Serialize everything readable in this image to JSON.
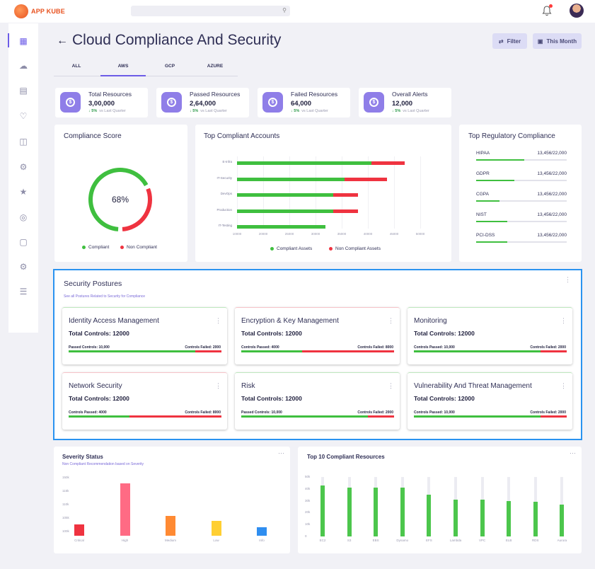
{
  "app": {
    "name": "APP KUBE"
  },
  "header": {
    "title": "Cloud Compliance And Security",
    "filter_label": "Filter",
    "period_label": "This Month"
  },
  "tabs": [
    {
      "label": "ALL"
    },
    {
      "label": "AWS"
    },
    {
      "label": "GCP"
    },
    {
      "label": "AZURE"
    }
  ],
  "active_tab": "AWS",
  "stats": [
    {
      "label": "Total Resources",
      "value": "3,00,000",
      "delta": "5%",
      "vs": "vs Last Quarter"
    },
    {
      "label": "Passed Resources",
      "value": "2,64,000",
      "delta": "5%",
      "vs": "vs Last Quarter"
    },
    {
      "label": "Failed Resources",
      "value": "64,000",
      "delta": "5%",
      "vs": "vs Last Quarter"
    },
    {
      "label": "Overall Alerts",
      "value": "12,000",
      "delta": "5%",
      "vs": "vs Last Quarter"
    }
  ],
  "compliance_score": {
    "title": "Compliance Score",
    "value": "68%",
    "percent": 68,
    "legend": [
      {
        "label": "Compliant",
        "color": "#3fbf3f"
      },
      {
        "label": "Non Compliant",
        "color": "#ef3340"
      }
    ]
  },
  "top_accounts": {
    "title": "Top Compliant Accounts",
    "legend": [
      {
        "label": "Compliant Assets",
        "color": "#3fbf3f"
      },
      {
        "label": "Non Compliant Assets",
        "color": "#ef3340"
      }
    ]
  },
  "regulatory": {
    "title": "Top Regulatory Compliance",
    "items": [
      {
        "name": "HIPAA",
        "value": "13,456/22,000",
        "fraction": 0.53
      },
      {
        "name": "GDPR",
        "value": "13,456/22,000",
        "fraction": 0.42
      },
      {
        "name": "CGPA",
        "value": "13,456/22,000",
        "fraction": 0.26
      },
      {
        "name": "NIST",
        "value": "13,456/22,000",
        "fraction": 0.34
      },
      {
        "name": "PCI-DSS",
        "value": "13,456/22,000",
        "fraction": 0.34
      }
    ]
  },
  "security": {
    "title": "Security Postures",
    "subtitle": "See all Postures Related to Security for Compliance",
    "more": "⋮",
    "cards": [
      {
        "title": "Identity Access Management",
        "total": "Total Controls:  12000",
        "passed": "Passed Controls: 10,000",
        "failed": "Controls Failed: 2000",
        "pass_fraction": 0.83,
        "top": "green"
      },
      {
        "title": "Encryption & Key Management",
        "total": "Total Controls:  12000",
        "passed": "Controls Passed: 4000",
        "failed": "Controls Failed: 8000",
        "pass_fraction": 0.4,
        "top": "red"
      },
      {
        "title": "Monitoring",
        "total": "Total Controls:  12000",
        "passed": "Controls Passed: 10,000",
        "failed": "Controls Failed: 2000",
        "pass_fraction": 0.83,
        "top": "green"
      },
      {
        "title": "Network Security",
        "total": "Total Controls:  12000",
        "passed": "Controls Passed: 4000",
        "failed": "Controls Failed: 8000",
        "pass_fraction": 0.4,
        "top": "red"
      },
      {
        "title": "Risk",
        "total": "Total Controls:  12000",
        "passed": "Passed Controls: 10,000",
        "failed": "Controls Failed: 2000",
        "pass_fraction": 0.83,
        "top": "green"
      },
      {
        "title": "Vulnerability And Threat Management",
        "total": "Total Controls:  12000",
        "passed": "Controls Passed: 10,000",
        "failed": "Controls Failed: 2000",
        "pass_fraction": 0.83,
        "top": "green"
      }
    ]
  },
  "severity": {
    "title": "Severity Status",
    "subtitle": "Non Compliant  Recommendation based on Severity",
    "more": "···"
  },
  "top_resources": {
    "title": "Top 10 Compliant Resources",
    "more": "···"
  },
  "chart_data": [
    {
      "type": "bar",
      "orientation": "horizontal",
      "stacked": true,
      "categories": [
        "E-Infra",
        "IT-Security",
        "DevOps",
        "Production",
        "IT-Testing"
      ],
      "series": [
        {
          "name": "Compliant Assets",
          "color": "#3fbf3f",
          "values": [
            35000,
            28000,
            25000,
            25000,
            23000
          ]
        },
        {
          "name": "Non Compliant Assets",
          "color": "#ef3340",
          "values": [
            8500,
            11000,
            6500,
            6500,
            0
          ]
        }
      ],
      "xticks": [
        "10000",
        "20000",
        "25000",
        "30000",
        "35000",
        "40000",
        "45000",
        "50000"
      ],
      "xlim": [
        10000,
        50000
      ]
    },
    {
      "type": "bar",
      "categories": [
        "Critical",
        "High",
        "Medium",
        "Low",
        "Info"
      ],
      "values": [
        125,
        178,
        136,
        129,
        121
      ],
      "colors": [
        "#ef3340",
        "#ff6b84",
        "#ff8a33",
        "#ffcf33",
        "#2f8ef0"
      ],
      "yticks": [
        "100k",
        "105k",
        "110k",
        "115k",
        "150k"
      ],
      "ylim": [
        110,
        185
      ]
    },
    {
      "type": "bar",
      "categories": [
        "EC2",
        "S3",
        "EBS",
        "Dynamo",
        "EFS",
        "Lambda",
        "VPC",
        "ELB",
        "RDS",
        "Aurora"
      ],
      "values": [
        43,
        41,
        41,
        41,
        35,
        31,
        31,
        30,
        29,
        27
      ],
      "background_values": [
        50,
        50,
        50,
        50,
        50,
        50,
        50,
        50,
        50,
        50
      ],
      "color": "#4cc64c",
      "yticks": [
        "0",
        "10k",
        "20k",
        "30k",
        "40k",
        "50k"
      ],
      "ylim": [
        0,
        50
      ]
    }
  ]
}
